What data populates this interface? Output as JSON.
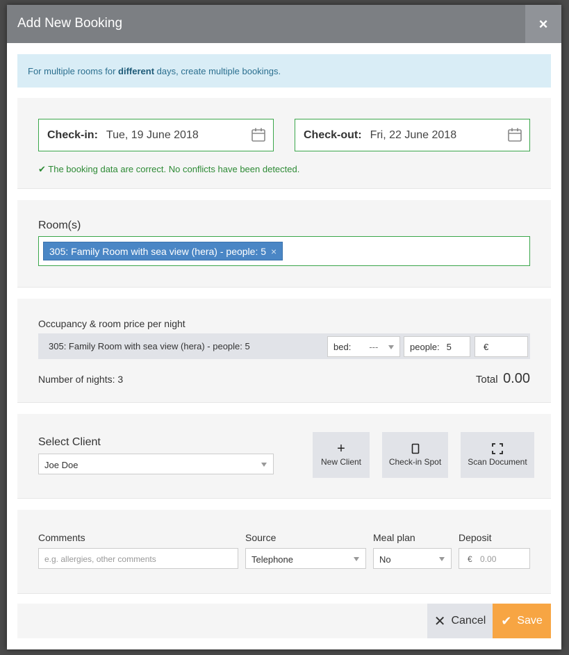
{
  "modal": {
    "title": "Add New Booking",
    "close_label": "×"
  },
  "alert": {
    "pre": "For multiple rooms for ",
    "bold": "different",
    "post": " days, create multiple bookings."
  },
  "dates": {
    "checkin_label": "Check-in:",
    "checkin_value": "Tue, 19 June 2018",
    "checkout_label": "Check-out:",
    "checkout_value": "Fri, 22 June 2018",
    "status_msg": "The booking data are correct. No conflicts have been detected."
  },
  "rooms": {
    "label": "Room(s)",
    "selected": "305: Family Room with sea view (hera) - people: 5",
    "remove_label": "×"
  },
  "occupancy": {
    "heading": "Occupancy & room price per night",
    "room": "305: Family Room with sea view (hera) - people: 5",
    "bed_label": "bed:",
    "bed_value": "---",
    "people_label": "people:",
    "people_value": "5",
    "currency": "€",
    "nights_text": "Number of nights: 3",
    "total_label": "Total",
    "total_value": "0.00"
  },
  "client": {
    "label": "Select Client",
    "value": "Joe Doe",
    "new_client": "New Client",
    "checkin_spot": "Check-in Spot",
    "scan_document": "Scan Document"
  },
  "extras": {
    "comments_label": "Comments",
    "comments_placeholder": "e.g. allergies, other comments",
    "source_label": "Source",
    "source_value": "Telephone",
    "meal_label": "Meal plan",
    "meal_value": "No",
    "deposit_label": "Deposit",
    "deposit_currency": "€",
    "deposit_placeholder": "0.00"
  },
  "footer": {
    "cancel": "Cancel",
    "save": "Save"
  },
  "colors": {
    "header": "#7c7f83",
    "valid_green": "#3aa64a",
    "tag_blue": "#4a86c5",
    "save_orange": "#f7a543"
  }
}
